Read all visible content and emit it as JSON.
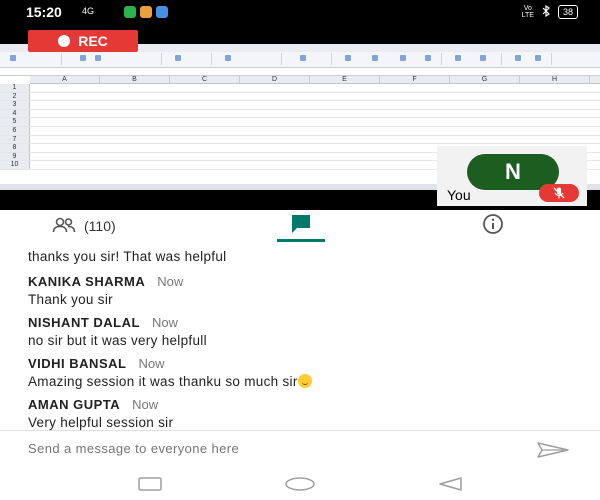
{
  "status_bar": {
    "time": "15:20",
    "signal_text": "4G",
    "volte_line1": "Vo",
    "volte_line2": "LTE",
    "battery": "38"
  },
  "meeting": {
    "rec_label": "REC",
    "shared_screen": {
      "columns": [
        "A",
        "B",
        "C",
        "D",
        "E",
        "F",
        "G",
        "H"
      ],
      "rows": [
        "1",
        "2",
        "3",
        "4",
        "5",
        "6",
        "7",
        "8",
        "9",
        "10"
      ]
    },
    "self_tile": {
      "initial": "N",
      "label": "You",
      "avatar_color": "#1b5e20",
      "mute_color": "#e53935"
    }
  },
  "tabs": {
    "people_count": "(110)",
    "active": "chat",
    "accent": "#00796b"
  },
  "chat": {
    "partial_top": {
      "body": "thanks you sir! That was helpful"
    },
    "messages": [
      {
        "name": "KANIKA SHARMA",
        "time": "Now",
        "body": "Thank you sir"
      },
      {
        "name": "NISHANT DALAL",
        "time": "Now",
        "body": "no sir but it was very helpfull"
      },
      {
        "name": "VIDHI BANSAL",
        "time": "Now",
        "body": "Amazing session it was thanku so much sir"
      },
      {
        "name": "AMAN GUPTA",
        "time": "Now",
        "body": "Very helpful session sir"
      }
    ]
  },
  "compose": {
    "placeholder": "Send a message to everyone here"
  }
}
